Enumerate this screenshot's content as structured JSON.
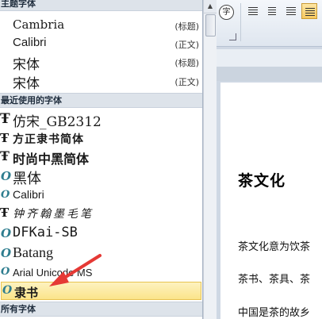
{
  "panel": {
    "theme_header": "主题字体",
    "recent_header": "最近使用的字体",
    "all_header": "所有字体",
    "theme_fonts": [
      {
        "name": "Cambria",
        "tag": "(标题)"
      },
      {
        "name": "Calibri",
        "tag": "(正文)"
      },
      {
        "name": "宋体",
        "tag": "(标题)"
      },
      {
        "name": "宋体",
        "tag": "(正文)"
      }
    ],
    "recent_fonts": [
      {
        "name": "仿宋_GB2312",
        "icon": "truetype-icon"
      },
      {
        "name": "方正隶书简体",
        "icon": "truetype-icon"
      },
      {
        "name": "时尚中黑简体",
        "icon": "truetype-icon"
      },
      {
        "name": "黑体",
        "icon": "opentype-icon"
      },
      {
        "name": "Calibri",
        "icon": "opentype-icon"
      },
      {
        "name": "钟齐翰墨毛笔",
        "icon": "truetype-icon"
      },
      {
        "name": "DFKai-SB",
        "icon": "opentype-icon"
      },
      {
        "name": "Batang",
        "icon": "opentype-icon"
      },
      {
        "name": "Arial Unicode MS",
        "icon": "opentype-icon"
      },
      {
        "name": "隶书",
        "icon": "opentype-icon",
        "selected": true
      }
    ]
  },
  "ribbon": {
    "phonetic_glyph": "字"
  },
  "document": {
    "title": "茶文化",
    "lines": [
      "茶文化意为饮茶",
      "茶书、茶具、茶",
      "中国是茶的故乡"
    ]
  },
  "colors": {
    "accent_selection": "#fbe48a",
    "arrow": "#e53935"
  }
}
